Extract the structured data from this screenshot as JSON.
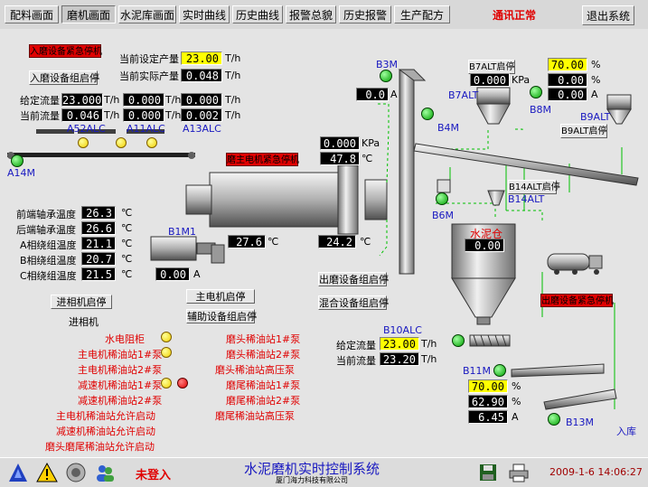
{
  "menu": {
    "tabs": [
      "配料画面",
      "磨机画面",
      "水泥库画面",
      "实时曲线",
      "历史曲线",
      "报警总貌",
      "历史报警",
      "生产配方"
    ],
    "active_index": 1,
    "status": "通讯正常",
    "exit": "退出系统"
  },
  "colors": {
    "value_bg": "#000000",
    "value_text": "#ffffff",
    "setpoint_bg": "#ffff00",
    "alarm_red": "#e00000",
    "motor_green": "#00a000",
    "indicator_yellow": "#f0d000",
    "title_blue": "#1818c0"
  },
  "mill_in": {
    "estop": "入磨设备紧急停机",
    "group_start": "入磨设备组启停",
    "set_output_label": "当前设定产量",
    "set_output": "23.00",
    "actual_output_label": "当前实际产量",
    "actual_output": "0.048",
    "unit_th": "T/h",
    "given_flow_label": "给定流量",
    "current_flow_label": "当前流量",
    "given_flows": [
      "23.000",
      "0.000",
      "0.000"
    ],
    "current_flows": [
      "0.046",
      "0.000",
      "0.002"
    ],
    "feeders": [
      "A52ALC",
      "A11ALC",
      "A13ALC"
    ],
    "belt": "A14M"
  },
  "mill": {
    "estop": "磨主电机紧急停机",
    "pressure": "0.000",
    "pressure_unit": "KPa",
    "temp_out": "47.8",
    "temp_outlet": "24.2",
    "temp_motor": "27.6",
    "temp_unit": "℃",
    "motor": "B1M1",
    "motor_current": "0.00",
    "current_unit": "A",
    "main_motor_btn": "主电机启停",
    "aux_btn": "辅助设备组启停"
  },
  "bearings": [
    {
      "label": "前端轴承温度",
      "value": "26.3"
    },
    {
      "label": "后端轴承温度",
      "value": "26.6"
    },
    {
      "label": "A相绕组温度",
      "value": "21.1"
    },
    {
      "label": "B相绕组温度",
      "value": "20.7"
    },
    {
      "label": "C相绕组温度",
      "value": "21.5"
    }
  ],
  "phase": {
    "button": "进相机启停",
    "label": "进相机"
  },
  "indicators_left": [
    {
      "label": "水电阻柜",
      "color": "yellow"
    },
    {
      "label": "主电机稀油站1#泵",
      "color": "yellow"
    },
    {
      "label": "主电机稀油站2#泵",
      "color": "none"
    },
    {
      "label": "减速机稀油站1#泵",
      "color": "yellow-red"
    },
    {
      "label": "减速机稀油站2#泵",
      "color": "none"
    },
    {
      "label": "主电机稀油站允许启动",
      "color": "none"
    },
    {
      "label": "减速机稀油站允许启动",
      "color": "none"
    },
    {
      "label": "磨头磨尾稀油站允许启动",
      "color": "none"
    }
  ],
  "indicators_mid": [
    "磨头稀油站1#泵",
    "磨头稀油站2#泵",
    "磨头稀油站高压泵",
    "磨尾稀油站1#泵",
    "磨尾稀油站2#泵",
    "磨尾稀油站高压泵"
  ],
  "elevator": {
    "motor": "B3M",
    "current": "0.0",
    "unit": "A"
  },
  "b7": {
    "btn": "B7ALT启停",
    "tag": "B7ALT",
    "pressure": "0.000",
    "pressure_unit": "KPa",
    "set": "70.00",
    "val1": "0.00",
    "val2": "0.00",
    "unit_pct": "%",
    "unit_a": "A",
    "b8": "B8M",
    "b4": "B4M"
  },
  "b9": {
    "tag": "B9ALT",
    "btn": "B9ALT启停"
  },
  "b14": {
    "btn": "B14ALT启停",
    "tag": "B14ALT",
    "b6": "B6M"
  },
  "silo": {
    "label": "水泥仓",
    "value": "0.00"
  },
  "mill_out": {
    "flow_btn": "出磨设备组启停",
    "mix_btn": "混合设备组启停",
    "estop": "出磨设备紧急停机"
  },
  "b10": {
    "tag": "B10ALC",
    "given_label": "给定流量",
    "given": "23.00",
    "current_label": "当前流量",
    "current": "23.20",
    "unit": "T/h"
  },
  "b11": {
    "tag": "B11M",
    "set": "70.00",
    "val1": "62.90",
    "val2": "6.45",
    "unit_pct": "%",
    "unit_a": "A",
    "b13": "B13M",
    "to_silo": "入库"
  },
  "footer": {
    "login": "未登入",
    "title": "水泥磨机实时控制系统",
    "company": "厦门海力科技有限公司",
    "datetime": "2009-1-6  14:06:27"
  }
}
